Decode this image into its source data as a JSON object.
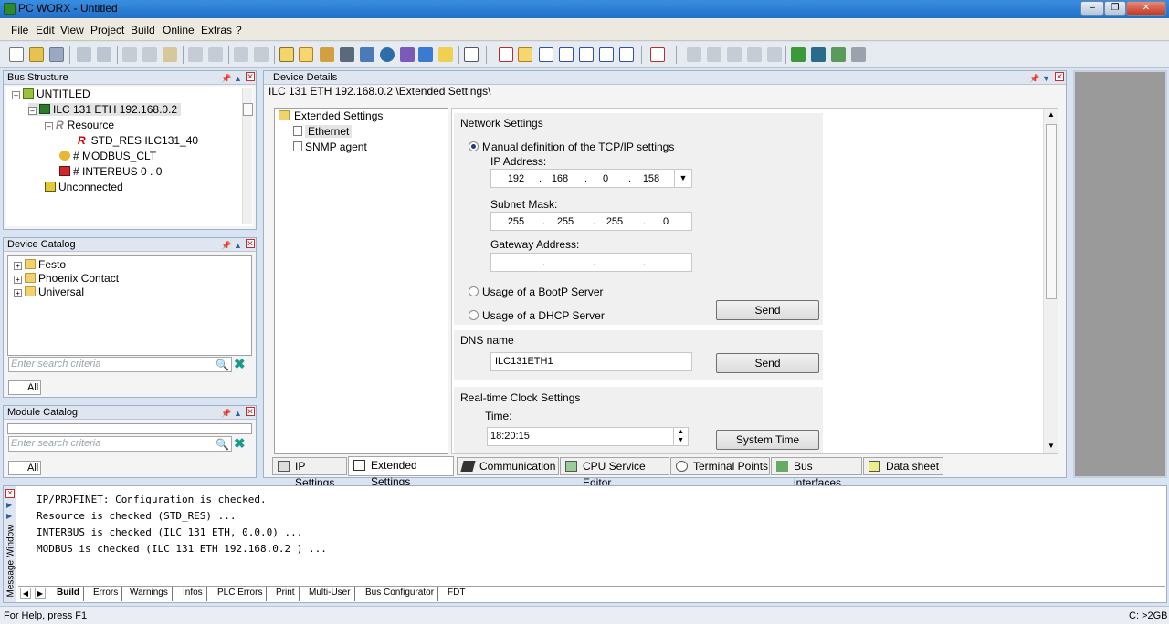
{
  "window": {
    "title": "PC WORX - Untitled"
  },
  "menu": [
    "File",
    "Edit",
    "View",
    "Project",
    "Build",
    "Online",
    "Extras",
    "?"
  ],
  "bus_structure": {
    "title": "Bus Structure",
    "items": [
      "UNTITLED",
      "ILC 131 ETH 192.168.0.2",
      "Resource",
      "STD_RES ILC131_40",
      "# MODBUS_CLT",
      "# INTERBUS 0 . 0",
      "Unconnected"
    ]
  },
  "device_catalog": {
    "title": "Device Catalog",
    "items": [
      "Festo",
      "Phoenix Contact",
      "Universal"
    ],
    "search_placeholder": "Enter search criteria",
    "tab": "All"
  },
  "module_catalog": {
    "title": "Module Catalog",
    "search_placeholder": "Enter search criteria",
    "tab": "All"
  },
  "device_details": {
    "title": "Device Details",
    "path": "ILC 131 ETH 192.168.0.2 \\Extended Settings\\",
    "nav": [
      "Extended Settings",
      "Ethernet",
      "SNMP agent"
    ],
    "network": {
      "title": "Network Settings",
      "manual_label": "Manual definition of the TCP/IP settings",
      "ip_label": "IP Address:",
      "ip": [
        "192",
        "168",
        "0",
        "158"
      ],
      "subnet_label": "Subnet Mask:",
      "subnet": [
        "255",
        "255",
        "255",
        "0"
      ],
      "gateway_label": "Gateway Address:",
      "bootp_label": "Usage of a BootP Server",
      "dhcp_label": "Usage of a DHCP Server",
      "send_label": "Send"
    },
    "dns": {
      "title": "DNS name",
      "value": "ILC131ETH1",
      "send_label": "Send"
    },
    "rtc": {
      "title": "Real-time Clock Settings",
      "time_label": "Time:",
      "time_value": "18:20:15",
      "system_time_label": "System Time"
    },
    "tabs": [
      "IP Settings",
      "Extended Settings",
      "Communication",
      "CPU Service Editor",
      "Terminal Points",
      "Bus interfaces",
      "Data sheet"
    ]
  },
  "message_window": {
    "title": "Message Window",
    "lines": [
      "IP/PROFINET: Configuration is checked.",
      "Resource is checked (STD_RES) ...",
      "INTERBUS is checked (ILC 131 ETH, 0.0.0) ...",
      "MODBUS is checked (ILC 131 ETH 192.168.0.2 ) ..."
    ],
    "tabs": [
      "Build",
      "Errors",
      "Warnings",
      "Infos",
      "PLC Errors",
      "Print",
      "Multi-User",
      "Bus Configurator",
      "FDT"
    ]
  },
  "status": {
    "help": "For Help, press F1",
    "right": "C: >2GB"
  },
  "colors": {
    "title_bar": "#2a7ed6",
    "accent": "#1f6fc7",
    "panel_header": "#dfe6f0",
    "resource_red": "#cc0000"
  }
}
